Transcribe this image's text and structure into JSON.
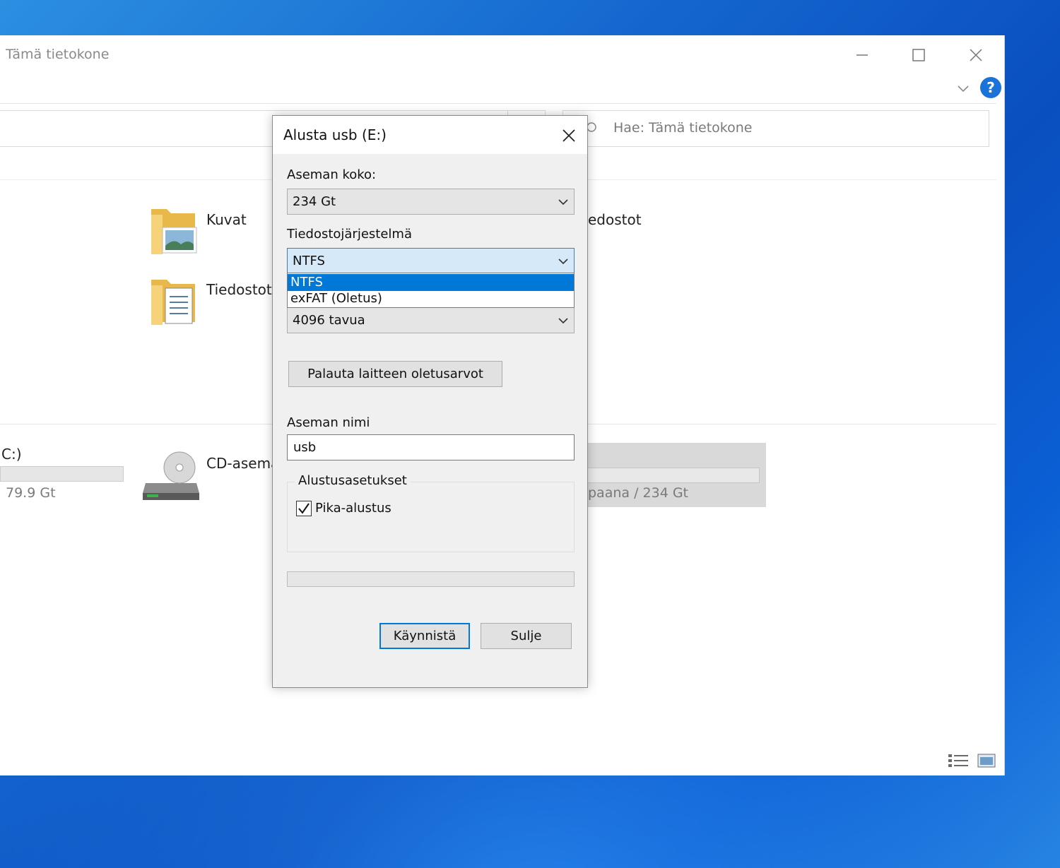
{
  "explorer": {
    "title": "Tämä tietokone",
    "search_placeholder": "Hae: Tämä tietokone",
    "help_label": "?",
    "folders": {
      "kuvat": "Kuvat",
      "tiedostot": "Tiedostot",
      "tiedostot_partial": "edostot"
    },
    "drives": {
      "c_label": "C:)",
      "c_size": "79.9 Gt",
      "cd_label": "CD-asema",
      "usb_size": "paana / 234 Gt"
    }
  },
  "dialog": {
    "title": "Alusta usb (E:)",
    "capacity_label": "Aseman koko:",
    "capacity_value": "234 Gt",
    "filesystem_label": "Tiedostojärjestelmä",
    "filesystem_value": "NTFS",
    "filesystem_options": [
      "NTFS",
      "exFAT (Oletus)"
    ],
    "allocation_value": "4096 tavua",
    "restore_button": "Palauta laitteen oletusarvot",
    "volume_label": "Aseman nimi",
    "volume_value": "usb",
    "format_options_title": "Alustusasetukset",
    "quick_format_label": "Pika-alustus",
    "quick_format_checked": true,
    "start_button": "Käynnistä",
    "close_button": "Sulje"
  },
  "colors": {
    "accent": "#0078d7",
    "help_blue": "#1a73d9",
    "desktop": "#1466cf"
  }
}
